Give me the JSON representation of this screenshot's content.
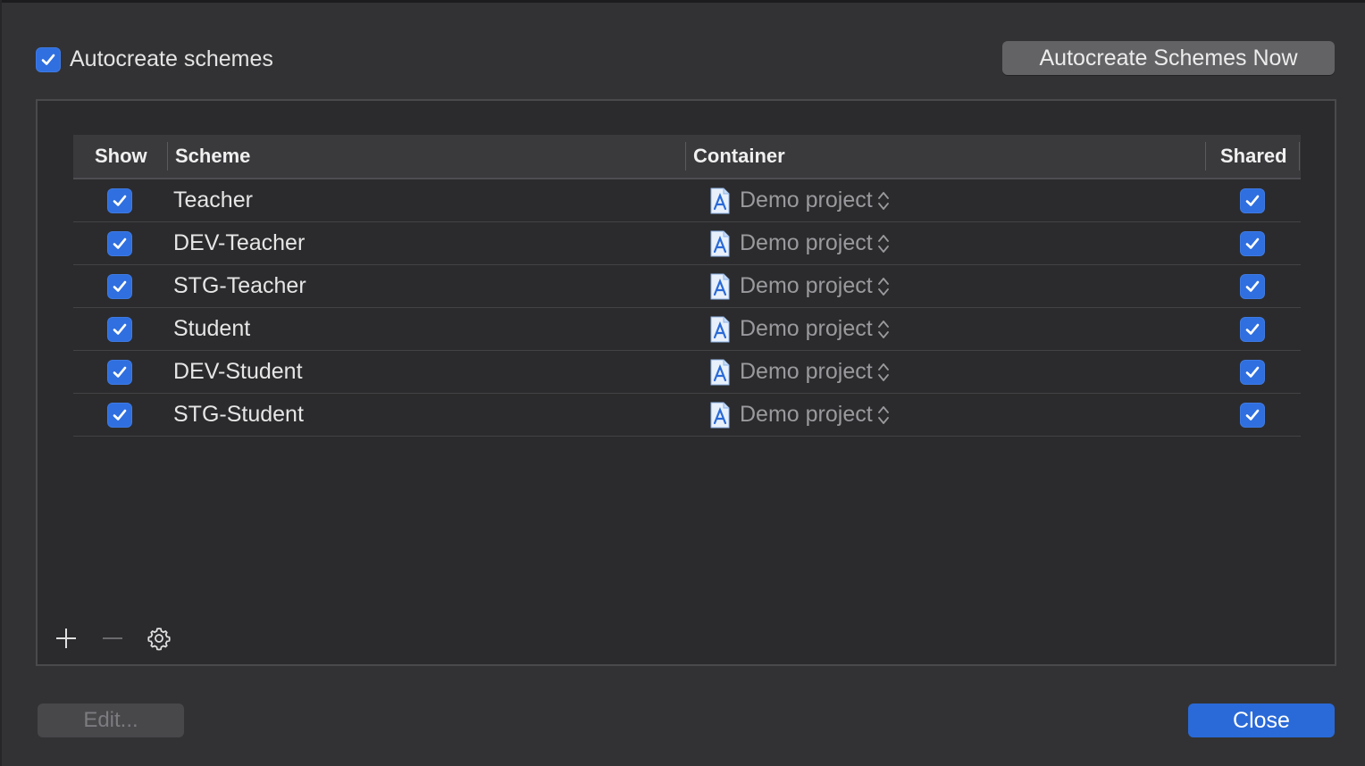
{
  "autocreate": {
    "label": "Autocreate schemes",
    "checked": true
  },
  "autocreate_now_button": "Autocreate Schemes Now",
  "table": {
    "columns": {
      "show": "Show",
      "scheme": "Scheme",
      "container": "Container",
      "shared": "Shared"
    },
    "rows": [
      {
        "show": true,
        "scheme": "Teacher",
        "container": "Demo project",
        "shared": true
      },
      {
        "show": true,
        "scheme": "DEV-Teacher",
        "container": "Demo project",
        "shared": true
      },
      {
        "show": true,
        "scheme": "STG-Teacher",
        "container": "Demo project",
        "shared": true
      },
      {
        "show": true,
        "scheme": "Student",
        "container": "Demo project",
        "shared": true
      },
      {
        "show": true,
        "scheme": "DEV-Student",
        "container": "Demo project",
        "shared": true
      },
      {
        "show": true,
        "scheme": "STG-Student",
        "container": "Demo project",
        "shared": true
      }
    ]
  },
  "toolbar": {
    "add_icon": "plus-icon",
    "remove_icon": "minus-icon",
    "settings_icon": "gear-icon"
  },
  "footer": {
    "edit_label": "Edit...",
    "close_label": "Close"
  },
  "colors": {
    "accent": "#2f6fe0",
    "background": "#323234",
    "panel": "#2b2b2d"
  }
}
